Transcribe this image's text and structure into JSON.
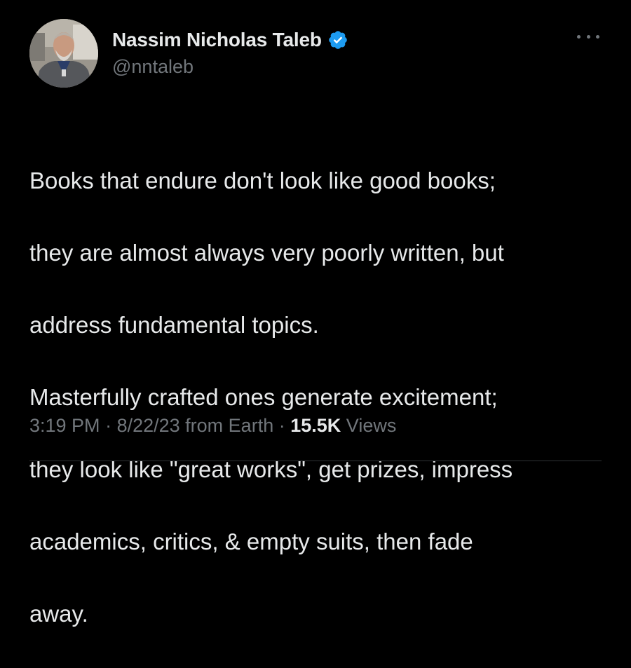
{
  "author": {
    "display_name": "Nassim Nicholas Taleb",
    "handle": "@nntaleb",
    "verified": true,
    "verified_badge_color": "#1d9bf0"
  },
  "tweet": {
    "text_lines": [
      "Books that endure don't look like good books;",
      "they are almost always very poorly written, but",
      "address fundamental topics.",
      "Masterfully crafted ones generate excitement;",
      "they look like \"great works\", get prizes, impress",
      "academics, critics, & empty suits, then fade",
      "away."
    ]
  },
  "meta": {
    "time": "3:19 PM",
    "separator": " · ",
    "date": "8/22/23",
    "source": "from Earth",
    "views_count": "15.5K",
    "views_label": "Views"
  },
  "icons": {
    "more": "more-horizontal-icon",
    "verified": "verified-badge-icon"
  },
  "colors": {
    "background": "#000000",
    "primary_text": "#e7e9ea",
    "secondary_text": "#71767b",
    "divider": "#2f3336"
  }
}
